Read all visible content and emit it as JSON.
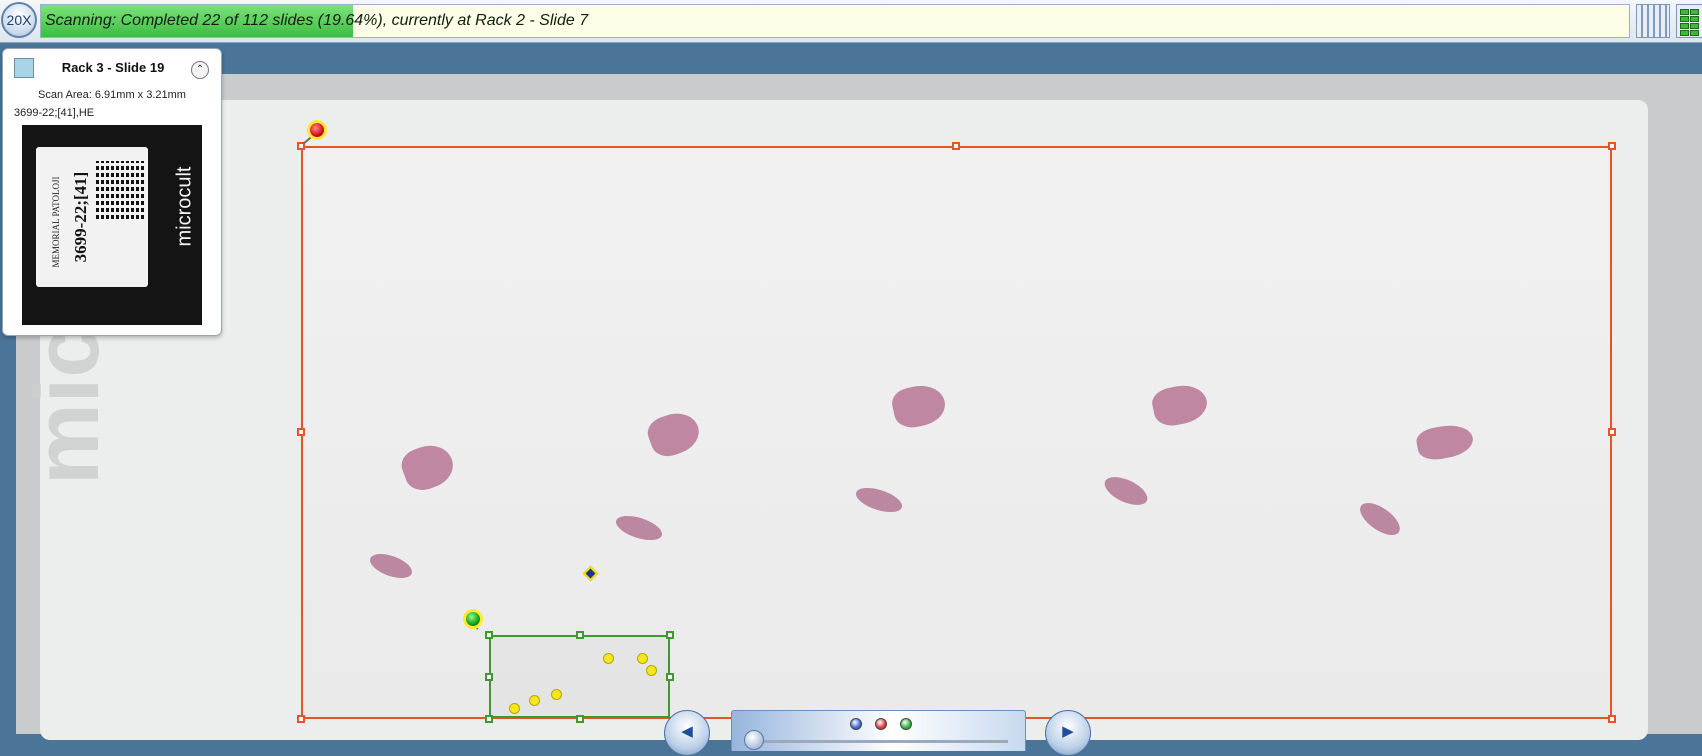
{
  "toolbar": {
    "magnification_label": "20X",
    "status_text": "Scanning: Completed 22 of 112 slides (19.64%), currently at Rack 2 - Slide 7",
    "progress_fraction": 0.1964,
    "progress_color": "#4cc84c",
    "view_buttons": [
      "columns-view-icon",
      "grid-view-icon"
    ]
  },
  "slide_info": {
    "title": "Rack 3 - Slide 19",
    "scan_area": "Scan Area: 6.91mm x 3.21mm",
    "slide_id": "3699-22;[41],HE",
    "swatch_color": "#a9d3e6",
    "label_image": {
      "lab_text": "MEMORIAL PATOLOJI",
      "id_text": "3699-22;[41]",
      "brand_text": "microcult"
    }
  },
  "scan_region": {
    "border_color": "#e3542a",
    "focus_region_color": "#3f9a2e"
  },
  "navigator": {
    "prev_icon": "skip-previous-icon",
    "next_icon": "skip-next-icon",
    "dots": [
      "#3d63d6",
      "#d63a3a",
      "#2fae3a"
    ]
  }
}
